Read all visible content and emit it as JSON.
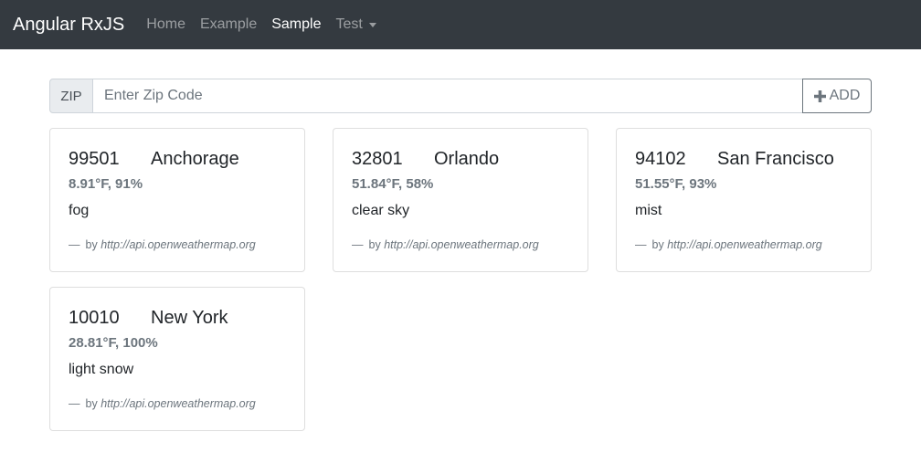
{
  "navbar": {
    "brand": "Angular RxJS",
    "links": [
      "Home",
      "Example",
      "Sample",
      "Test"
    ],
    "active": "Sample"
  },
  "zip_form": {
    "prepend": "ZIP",
    "placeholder": "Enter Zip Code",
    "value": "",
    "add_label": "ADD"
  },
  "cards": [
    {
      "zip": "99501",
      "city": "Anchorage",
      "conditions": "8.91°F, 91%",
      "description": "fog",
      "source_prefix": "by",
      "source": "http://api.openweathermap.org"
    },
    {
      "zip": "32801",
      "city": "Orlando",
      "conditions": "51.84°F, 58%",
      "description": "clear sky",
      "source_prefix": "by",
      "source": "http://api.openweathermap.org"
    },
    {
      "zip": "94102",
      "city": "San Francisco",
      "conditions": "51.55°F, 93%",
      "description": "mist",
      "source_prefix": "by",
      "source": "http://api.openweathermap.org"
    },
    {
      "zip": "10010",
      "city": "New York",
      "conditions": "28.81°F, 100%",
      "description": "light snow",
      "source_prefix": "by",
      "source": "http://api.openweathermap.org"
    }
  ],
  "colors": {
    "navbar_bg": "#343a40",
    "muted": "#6c757d",
    "text": "#212529"
  },
  "icons": {
    "add": "plus-icon",
    "dropdown": "caret-down-icon",
    "footer_dash": "em-dash"
  }
}
